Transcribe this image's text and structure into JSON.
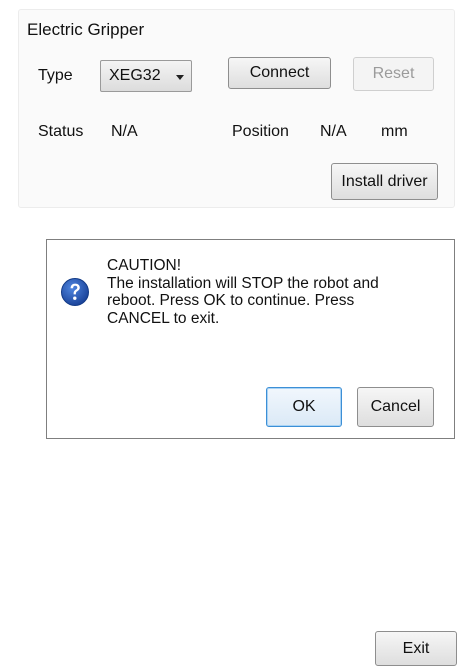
{
  "gripper": {
    "title": "Electric Gripper",
    "type_label": "Type",
    "type_value": "XEG32",
    "connect_label": "Connect",
    "reset_label": "Reset",
    "status_label": "Status",
    "status_value": "N/A",
    "position_label": "Position",
    "position_value": "N/A",
    "position_unit": "mm",
    "install_driver_label": "Install driver"
  },
  "dialog": {
    "icon": "question-icon",
    "heading": "CAUTION!",
    "message_lines": [
      "The installation will STOP the robot and",
      "reboot. Press OK to continue. Press",
      "CANCEL to exit."
    ],
    "ok_label": "OK",
    "cancel_label": "Cancel"
  },
  "footer": {
    "exit_label": "Exit"
  },
  "colors": {
    "accent": "#3c8fd6",
    "icon_blue": "#1d4fa8"
  }
}
